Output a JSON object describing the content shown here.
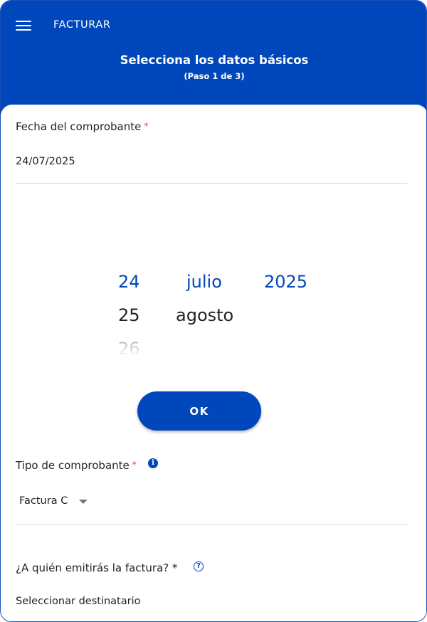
{
  "appbar": {
    "title": "FACTURAR",
    "menu_icon": "hamburger-menu-icon"
  },
  "step": {
    "title": "Selecciona los datos básicos",
    "subtitle": "(Paso 1 de 3)"
  },
  "fecha": {
    "label": "Fecha del comprobante",
    "required_mark": "*",
    "value": "24/07/2025"
  },
  "picker": {
    "day_selected": "24",
    "day_next": "25",
    "day_after": "26",
    "month_selected": "julio",
    "month_next": "agosto",
    "year_selected": "2025",
    "ok_label": "OK"
  },
  "tipo": {
    "label": "Tipo de comprobante",
    "required_mark": "*",
    "info_icon": "info-icon",
    "info_glyph": "i",
    "selected": "Factura C"
  },
  "destinatario": {
    "label": "¿A quién emitirás la factura? *",
    "help_icon": "help-icon",
    "help_glyph": "?",
    "placeholder": "Seleccionar destinatario"
  },
  "colors": {
    "primary": "#0047bb",
    "required": "#e53935"
  }
}
